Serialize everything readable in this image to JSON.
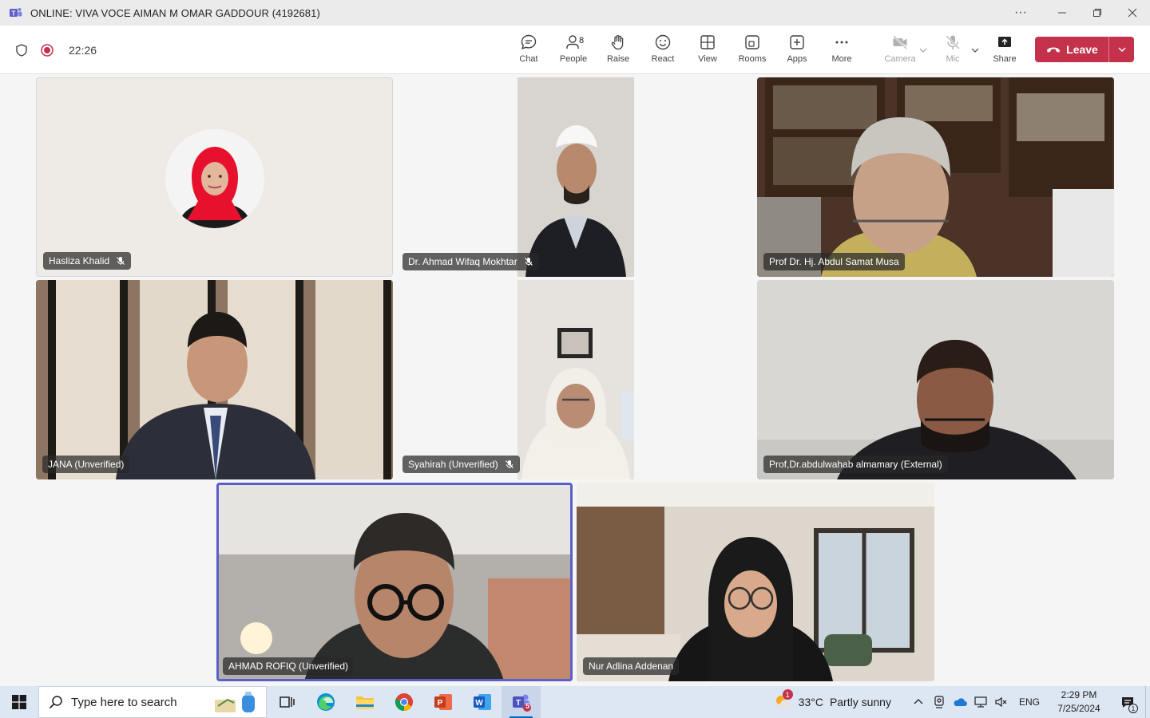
{
  "window": {
    "title": "ONLINE: VIVA VOCE AIMAN M OMAR GADDOUR (4192681)",
    "more_label": "···"
  },
  "toolbar": {
    "timer": "22:26",
    "chat": "Chat",
    "people": "People",
    "people_count": "8",
    "raise": "Raise",
    "react": "React",
    "view": "View",
    "rooms": "Rooms",
    "apps": "Apps",
    "more": "More",
    "camera": "Camera",
    "mic": "Mic",
    "share": "Share",
    "leave": "Leave"
  },
  "participants": [
    {
      "name": "Hasliza Khalid",
      "muted": true
    },
    {
      "name": "Dr. Ahmad Wifaq Mokhtar",
      "muted": true
    },
    {
      "name": "Prof Dr. Hj. Abdul Samat Musa",
      "muted": false
    },
    {
      "name": "JANA (Unverified)",
      "muted": false
    },
    {
      "name": "Syahirah (Unverified)",
      "muted": true
    },
    {
      "name": "Prof,Dr.abdulwahab almamary (External)",
      "muted": false
    },
    {
      "name": "AHMAD ROFIQ (Unverified)",
      "muted": false,
      "active_speaker": true
    },
    {
      "name": "Nur Adlina Addenan",
      "muted": false
    }
  ],
  "taskbar": {
    "search_placeholder": "Type here to search",
    "teams_badge": "5",
    "weather_temp": "33°C",
    "weather_text": "Partly sunny",
    "weather_alert": "1",
    "language": "ENG",
    "time": "2:29 PM",
    "date": "7/25/2024",
    "notification_count": "1"
  },
  "colors": {
    "leave": "#c4314b",
    "active_speaker": "#5b5fc7",
    "taskbar": "#dde6f3"
  }
}
